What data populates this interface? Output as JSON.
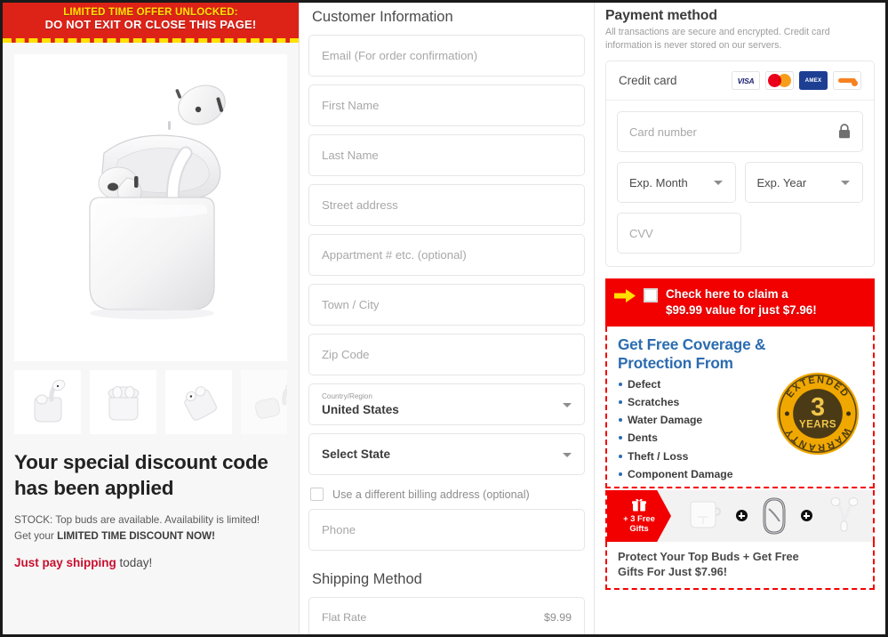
{
  "left": {
    "banner": {
      "line1": "LIMITED TIME OFFER UNLOCKED:",
      "line2": "DO NOT EXIT OR CLOSE THIS PAGE!"
    },
    "product_alt": "White wireless earbuds in open charging case",
    "thumbnails": [
      {
        "alt": "Earbud above open case"
      },
      {
        "alt": "Earbuds inside open case front view"
      },
      {
        "alt": "Case tilted with earbuds"
      },
      {
        "alt": "Case and earbud angled view"
      }
    ],
    "headline": "Your special discount code has been applied",
    "stock_line1_prefix": "STOCK: Top buds are available. Availability is limited!",
    "stock_line2_prefix": "Get your ",
    "stock_line2_strong": "LIMITED TIME DISCOUNT NOW!",
    "shipping_strong": "Just pay shipping",
    "shipping_rest": " today!"
  },
  "customer": {
    "section_title": "Customer Information",
    "fields": [
      {
        "name": "email",
        "placeholder": "Email (For order confirmation)"
      },
      {
        "name": "first-name",
        "placeholder": "First Name"
      },
      {
        "name": "last-name",
        "placeholder": "Last Name"
      },
      {
        "name": "street-address",
        "placeholder": "Street address"
      },
      {
        "name": "apartment",
        "placeholder": "Appartment # etc. (optional)"
      },
      {
        "name": "town-city",
        "placeholder": "Town / City"
      },
      {
        "name": "zip-code",
        "placeholder": "Zip Code"
      }
    ],
    "country": {
      "label": "Country/Region",
      "value": "United States"
    },
    "state": {
      "placeholder": "Select State"
    },
    "billing_checkbox_label": "Use a different billing address (optional)",
    "phone_placeholder": "Phone",
    "shipping_title": "Shipping Method",
    "shipping_option": {
      "name": "Flat Rate",
      "price": "$9.99"
    }
  },
  "payment": {
    "title": "Payment method",
    "subtitle": "All transactions are secure and encrypted. Credit card information is never stored on our servers.",
    "credit_card_label": "Credit card",
    "brands": [
      {
        "name": "visa",
        "text": "VISA"
      },
      {
        "name": "mastercard",
        "text": ""
      },
      {
        "name": "amex",
        "text": "AMEX"
      },
      {
        "name": "discover",
        "text": ""
      }
    ],
    "card_number_placeholder": "Card number",
    "exp_month_placeholder": "Exp. Month",
    "exp_year_placeholder": "Exp. Year",
    "cvv_placeholder": "CVV"
  },
  "upsell": {
    "claim_line1": "Check here to claim a",
    "claim_line2": "$99.99 value for just $7.96!",
    "coverage_heading": "Get Free Coverage & Protection From",
    "coverage_items": [
      "Defect",
      "Scratches",
      "Water Damage",
      "Dents",
      "Theft / Loss",
      "Component Damage"
    ],
    "badge": {
      "top": "EXTENDED",
      "number": "3",
      "years": "YEARS",
      "bottom": "WARRANTY"
    },
    "gift_tag_line1": "+ 3 Free",
    "gift_tag_line2": "Gifts",
    "gift_items": [
      {
        "alt": "Charging case"
      },
      {
        "alt": "Carabiner clip"
      },
      {
        "alt": "Earbuds with cord"
      }
    ],
    "footer_line1": "Protect Your Top Buds + Get Free",
    "footer_line2": "Gifts For Just $7.96!"
  },
  "colors": {
    "urgency_red": "#dd2218",
    "urgency_yellow": "#ffe400",
    "claim_red": "#f20000",
    "coverage_blue": "#2b6cb0",
    "badge_gold": "#f0a800",
    "shipping_red": "#c8102e"
  }
}
